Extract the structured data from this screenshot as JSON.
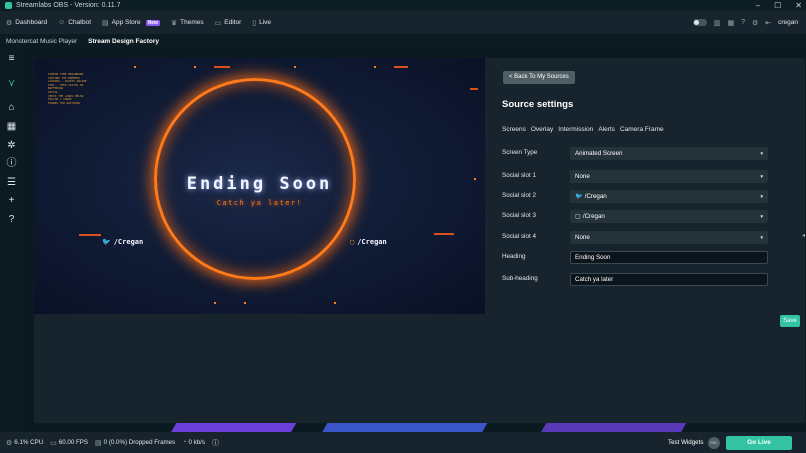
{
  "titlebar": {
    "title": "Streamlabs OBS - Version: 0.11.7",
    "minimize": "–",
    "maximize": "☐",
    "close": "✕"
  },
  "nav": {
    "items": [
      {
        "label": "Dashboard",
        "icon": "dashboard-icon"
      },
      {
        "label": "Chatbot",
        "icon": "chatbot-icon"
      },
      {
        "label": "App Store",
        "icon": "app-store-icon",
        "badge": "New"
      },
      {
        "label": "Themes",
        "icon": "themes-icon"
      },
      {
        "label": "Editor",
        "icon": "editor-icon"
      },
      {
        "label": "Live",
        "icon": "live-icon"
      }
    ],
    "username": "cregan"
  },
  "studio_tabs": [
    {
      "label": "Monstercat Music Player",
      "active": false
    },
    {
      "label": "Stream Design Factory",
      "active": true
    }
  ],
  "preview": {
    "heading": "Ending Soon",
    "subheading": "Catch ya later!",
    "social_left": "/Cregan",
    "social_right": "/Cregan",
    "hud_lines": [
      "STREAM TIME BEGINNING",
      "CAPTURE THE MOMENTS",
      "LOADING — ASSETS ONLINE",
      "SYNC — FEED STATUS OK",
      "BUFFERING",
      "",
      "SOCIAL",
      "CHECK THE LINKS BELOW",
      "FOLLOW / SHARE",
      "THANKS FOR WATCHING"
    ]
  },
  "panel": {
    "back_label": "< Back To My Sources",
    "title": "Source settings",
    "tabs": [
      "Screens",
      "Overlay",
      "Intermission",
      "Alerts",
      "Camera Frame"
    ],
    "fields": [
      {
        "label": "Screen Type",
        "value": "Animated Screen",
        "type": "select"
      },
      {
        "label": "Social slot 1",
        "value": "None",
        "type": "select"
      },
      {
        "label": "Social slot 2",
        "value": "/Cregan",
        "type": "select",
        "icon": "twitter-icon"
      },
      {
        "label": "Social slot 3",
        "value": "/Cregan",
        "type": "select",
        "icon": "twitch-icon"
      },
      {
        "label": "Social slot 4",
        "value": "None",
        "type": "select"
      },
      {
        "label": "Heading",
        "value": "Ending Soon",
        "type": "input"
      },
      {
        "label": "Sub-heading",
        "value": "Catch ya later",
        "type": "input"
      }
    ],
    "save_label": "Save"
  },
  "footer": {
    "cpu": "6.1% CPU",
    "fps": "60.00 FPS",
    "dropped": "0 (0.0%) Dropped Frames",
    "bandwidth": "0 kb/s",
    "test_widgets": "Test Widgets",
    "rec_label": "REC",
    "golive": "Go Live"
  },
  "colors": {
    "accent": "#31c3a2",
    "badge": "#8b5cf6",
    "glow": "#ff7a1a",
    "panel_bg": "#17242d"
  }
}
